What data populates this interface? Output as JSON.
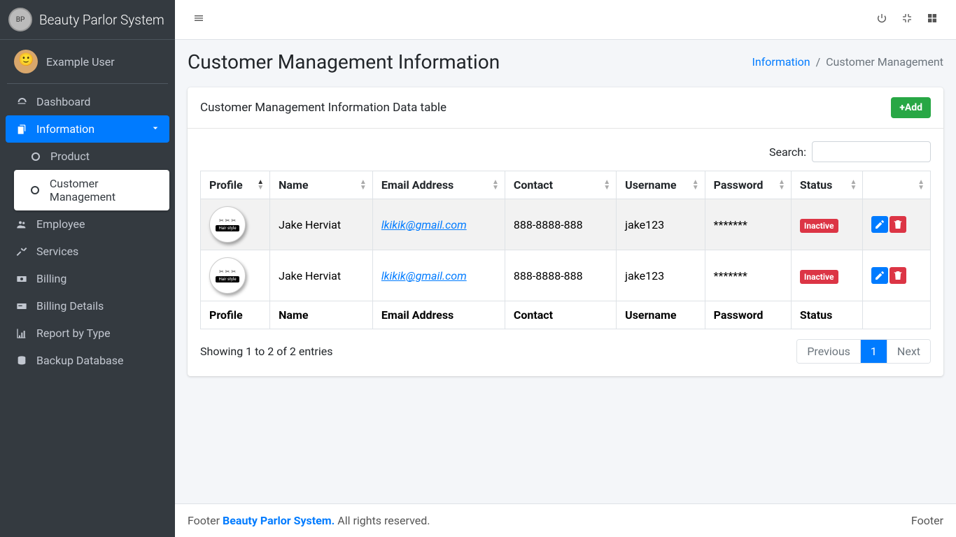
{
  "brand": {
    "name": "Beauty Parlor System"
  },
  "user": {
    "name": "Example User"
  },
  "sidebar": {
    "items": [
      {
        "label": "Dashboard"
      },
      {
        "label": "Information"
      },
      {
        "label": "Employee"
      },
      {
        "label": "Services"
      },
      {
        "label": "Billing"
      },
      {
        "label": "Billing Details"
      },
      {
        "label": "Report by Type"
      },
      {
        "label": "Backup Database"
      }
    ],
    "information_sub": [
      {
        "label": "Product"
      },
      {
        "label": "Customer Management"
      }
    ]
  },
  "page": {
    "title": "Customer Management Information",
    "breadcrumb": {
      "link": "Information",
      "sep": "/",
      "current": "Customer Management"
    },
    "card_title": "Customer Management Information Data table",
    "add_label": "Add",
    "search_label": "Search:",
    "search_value": ""
  },
  "table": {
    "columns": [
      "Profile",
      "Name",
      "Email Address",
      "Contact",
      "Username",
      "Password",
      "Status",
      ""
    ],
    "rows": [
      {
        "profile_tag": "Hair style",
        "name": "Jake Herviat",
        "email": "lkikik@gmail.com",
        "contact": "888-8888-888",
        "username": "jake123",
        "password": "*******",
        "status": "Inactive"
      },
      {
        "profile_tag": "Hair style",
        "name": "Jake Herviat",
        "email": "lkikik@gmail.com",
        "contact": "888-8888-888",
        "username": "jake123",
        "password": "*******",
        "status": "Inactive"
      }
    ],
    "info": "Showing 1 to 2 of 2 entries",
    "pagination": {
      "previous": "Previous",
      "page": "1",
      "next": "Next"
    }
  },
  "footer": {
    "left_prefix": "Footer ",
    "brand": "Beauty Parlor System.",
    "rights": " All rights reserved.",
    "right": "Footer"
  }
}
